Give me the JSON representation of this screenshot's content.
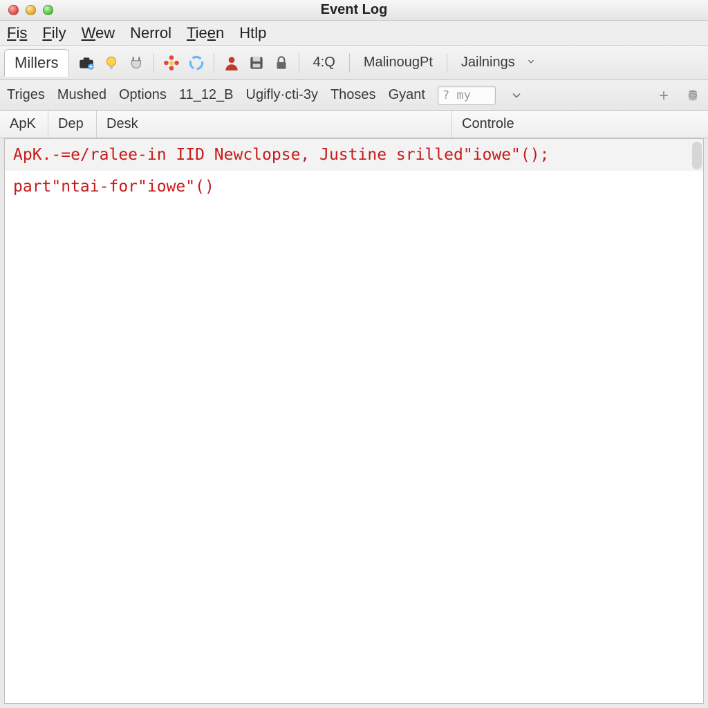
{
  "window": {
    "title": "Event Log"
  },
  "menu": {
    "items": [
      "Fis",
      "Fily",
      "Wew",
      "Nerrol",
      "Tieen",
      "Htlp"
    ]
  },
  "tabs": {
    "active": "Millers"
  },
  "toolbar": {
    "time_label": "4:Q",
    "btn_a": "MalinougPt",
    "btn_b": "Jailnings"
  },
  "toolbar2": {
    "items": [
      "Triges",
      "Mushed",
      "Options",
      "11_12_B",
      "Ugifly·cti-3y",
      "Thoses",
      "Gyant"
    ],
    "search_placeholder": "? my"
  },
  "columns": {
    "apk": "ApK",
    "dep": "Dep",
    "desk": "Desk",
    "ctrl": "Controle"
  },
  "log": {
    "lines": [
      "ApK.-=e/ralee-in IID Newclopse, Justine srilled\"iowe\"();",
      "part\"ntai-for\"iowe\"()"
    ]
  }
}
